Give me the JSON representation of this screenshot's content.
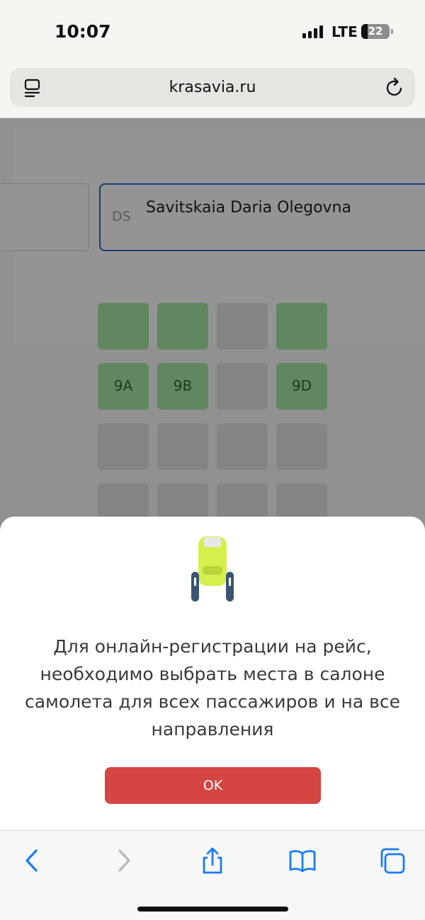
{
  "status": {
    "time": "10:07",
    "network": "LTE",
    "battery": "22",
    "battery_fraction": 0.22
  },
  "browser": {
    "url": "krasavia.ru"
  },
  "passenger": {
    "initials": "DS",
    "name": "Savitskaia Daria Olegovna"
  },
  "seats": {
    "row_top": [
      "",
      "",
      "",
      ""
    ],
    "row_9": [
      "9A",
      "9B",
      "",
      "9D"
    ]
  },
  "modal": {
    "message": "Для онлайн-регистрации на рейс, необходимо выбрать места в салоне самолета для всех пассажиров и на все направления",
    "ok_label": "OK"
  },
  "colors": {
    "accent_blue": "#2f66c6",
    "ok_red": "#d54541",
    "seat_green": "#a8e8a8",
    "seat_yellow": "#d4f04a"
  }
}
